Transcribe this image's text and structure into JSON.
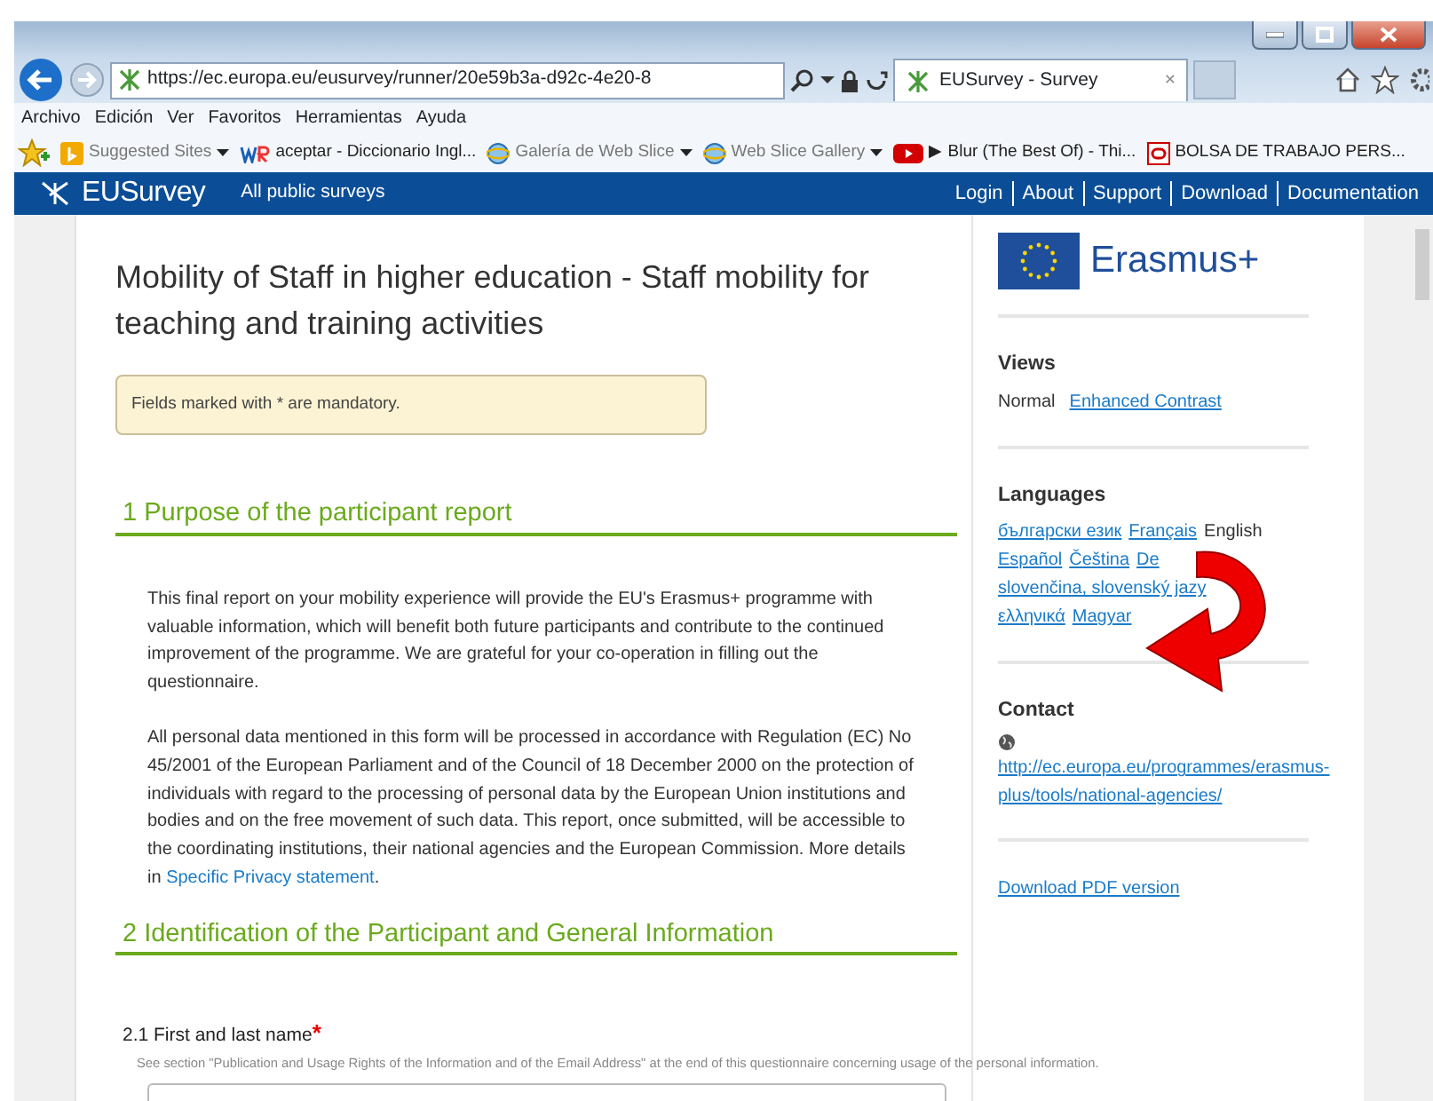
{
  "browser": {
    "address": "https://ec.europa.eu/eusurvey/runner/20e59b3a-d92c-4e20-8",
    "tab_title": "EUSurvey - Survey",
    "tab_close": "×",
    "menu": [
      "Archivo",
      "Edición",
      "Ver",
      "Favoritos",
      "Herramientas",
      "Ayuda"
    ],
    "favorites": [
      {
        "kind": "bing",
        "label": "Suggested Sites",
        "dropdown": true,
        "dimmed": true
      },
      {
        "kind": "wr",
        "label": "aceptar - Diccionario Ingl...",
        "dropdown": false,
        "dimmed": false
      },
      {
        "kind": "ie",
        "label": "Galería de Web Slice",
        "dropdown": true,
        "dimmed": true
      },
      {
        "kind": "ie",
        "label": "Web Slice Gallery",
        "dropdown": true,
        "dimmed": true
      },
      {
        "kind": "youtube",
        "label": "▶ Blur (The Best Of) - Thi...",
        "dropdown": false,
        "dimmed": false
      },
      {
        "kind": "oracle",
        "label": "BOLSA DE TRABAJO PERS...",
        "dropdown": false,
        "dimmed": false
      }
    ]
  },
  "site": {
    "brand": "EUSurvey",
    "link": "All public surveys",
    "nav": [
      "Login",
      "About",
      "Support",
      "Download",
      "Documentation"
    ]
  },
  "survey": {
    "title": "Mobility of Staff in higher education - Staff mobility for teaching and training activities",
    "notice": "Fields marked with * are mandatory.",
    "sections": [
      {
        "heading": "1 Purpose of the participant report",
        "paragraphs": [
          {
            "text": "This final report on your mobility experience will provide the EU's Erasmus+ programme with valuable information, which will benefit both future participants and contribute to the continued improvement of the programme. We are grateful for your co-operation in filling out the questionnaire."
          },
          {
            "text": "All personal data mentioned in this form will be processed in accordance with Regulation (EC) No 45/2001 of the European Parliament and of the Council of 18 December 2000 on the protection of individuals with regard to the processing of personal data by the European Union institutions and bodies and on the free movement of such data. This report, once submitted, will be accessible to the coordinating institutions, their national agencies and the European Commission. More details in ",
            "link": "Specific Privacy statement",
            "after": "."
          }
        ]
      },
      {
        "heading": "2 Identification of the Participant and General Information",
        "questions": [
          {
            "label": "2.1 First and last name",
            "required_mark": "*",
            "help": "See section \"Publication and Usage Rights of the Information and of the Email Address\" at the end of this questionnaire concerning usage of the personal information."
          }
        ]
      }
    ]
  },
  "sidebar": {
    "logo": "Erasmus+",
    "views": {
      "heading": "Views",
      "items": [
        {
          "label": "Normal",
          "selected": true
        },
        {
          "label": "Enhanced Contrast",
          "selected": false
        }
      ]
    },
    "languages": {
      "heading": "Languages",
      "items": [
        {
          "label": "български език",
          "selected": false
        },
        {
          "label": "Français",
          "selected": false
        },
        {
          "label": "English",
          "selected": true
        },
        {
          "label": "Español",
          "selected": false
        },
        {
          "label": "Čeština",
          "selected": false
        },
        {
          "label": "De",
          "selected": false
        },
        {
          "label": "slovenčina, slovenský jazy",
          "selected": false
        },
        {
          "label": "ελληνικά",
          "selected": false
        },
        {
          "label": "Magyar",
          "selected": false
        }
      ]
    },
    "contact": {
      "heading": "Contact",
      "url": "http://ec.europa.eu/programmes/erasmus-plus/tools/national-agencies/"
    },
    "pdf_link": "Download PDF version"
  }
}
